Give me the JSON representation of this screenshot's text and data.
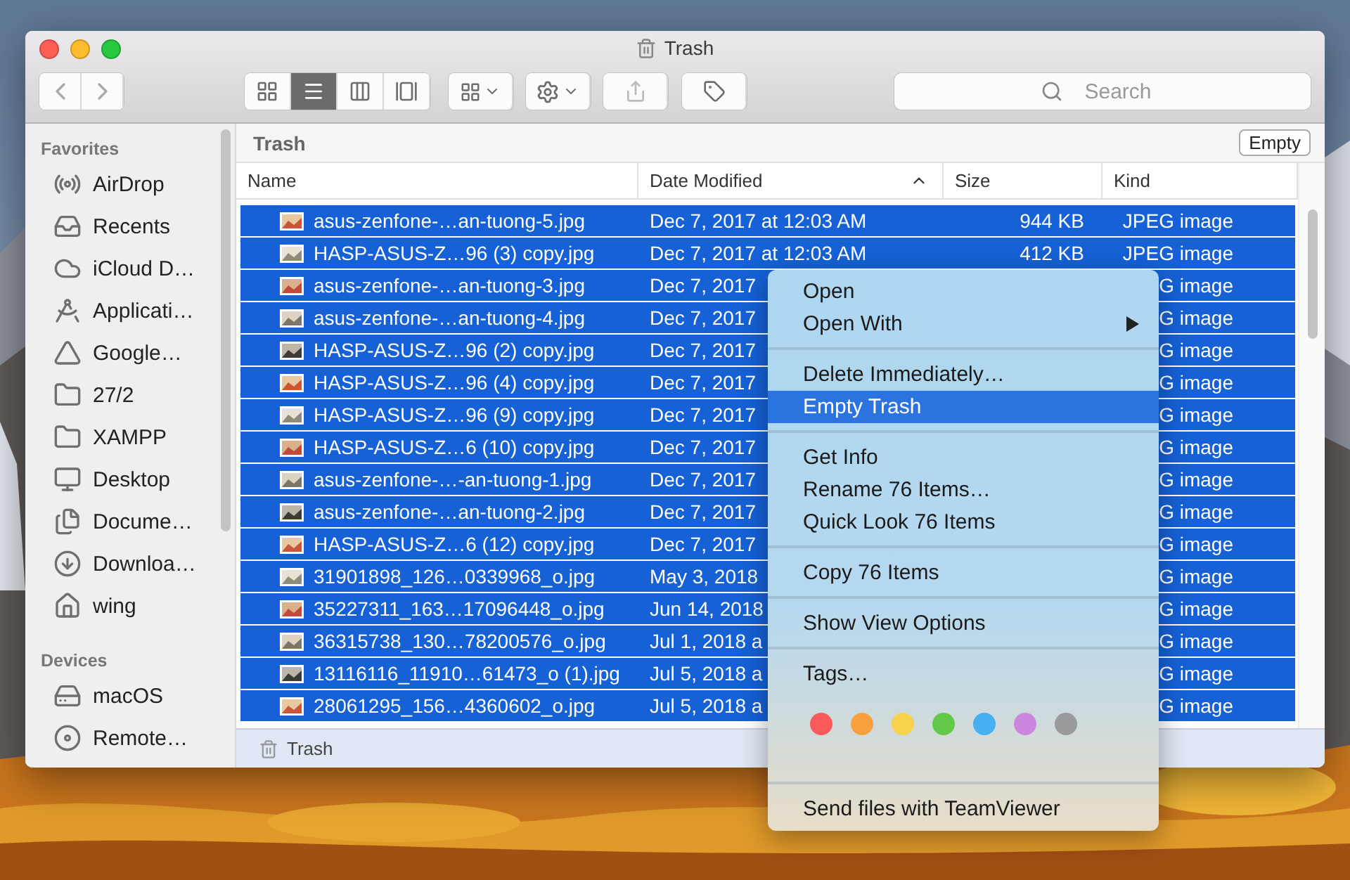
{
  "window": {
    "title": "Trash"
  },
  "toolbar": {
    "views": [
      {
        "kind": "icons",
        "selected": false
      },
      {
        "kind": "list",
        "selected": true
      },
      {
        "kind": "columns",
        "selected": false
      },
      {
        "kind": "gallery",
        "selected": false
      }
    ],
    "search": {
      "placeholder": "Search"
    }
  },
  "sidebar": {
    "sections": [
      {
        "title": "Favorites",
        "items": [
          {
            "label": "AirDrop",
            "kind": "airdrop"
          },
          {
            "label": "Recents",
            "kind": "recents"
          },
          {
            "label": "iCloud D…",
            "kind": "cloud"
          },
          {
            "label": "Applicati…",
            "kind": "apps"
          },
          {
            "label": "Google…",
            "kind": "gdrive"
          },
          {
            "label": "27/2",
            "kind": "folder"
          },
          {
            "label": "XAMPP",
            "kind": "folder"
          },
          {
            "label": "Desktop",
            "kind": "desktop"
          },
          {
            "label": "Docume…",
            "kind": "documents"
          },
          {
            "label": "Downloa…",
            "kind": "downloads"
          },
          {
            "label": "wing",
            "kind": "home"
          }
        ]
      },
      {
        "title": "Devices",
        "items": [
          {
            "label": "macOS",
            "kind": "disk"
          },
          {
            "label": "Remote…",
            "kind": "disc"
          }
        ]
      }
    ]
  },
  "path_bar": {
    "title": "Trash",
    "button": "Empty"
  },
  "table": {
    "columns": [
      {
        "label": "Name",
        "sorted": false
      },
      {
        "label": "Date Modified",
        "sorted": true
      },
      {
        "label": "Size",
        "sorted": false
      },
      {
        "label": "Kind",
        "sorted": false
      }
    ],
    "rows": [
      {
        "name": "asus-zenfone-…an-tuong-5.jpg",
        "date": "Dec 7, 2017 at 12:03 AM",
        "size": "944 KB",
        "kind": "JPEG image",
        "selected": true
      },
      {
        "name": "HASP-ASUS-Z…96 (3) copy.jpg",
        "date": "Dec 7, 2017 at 12:03 AM",
        "size": "412 KB",
        "kind": "JPEG image",
        "selected": true
      },
      {
        "name": "asus-zenfone-…an-tuong-3.jpg",
        "date": "Dec 7, 2017",
        "kind": "G image",
        "selected": true
      },
      {
        "name": "asus-zenfone-…an-tuong-4.jpg",
        "date": "Dec 7, 2017",
        "kind": "G image",
        "selected": true
      },
      {
        "name": "HASP-ASUS-Z…96 (2) copy.jpg",
        "date": "Dec 7, 2017",
        "kind": "G image",
        "selected": true
      },
      {
        "name": "HASP-ASUS-Z…96 (4) copy.jpg",
        "date": "Dec 7, 2017",
        "kind": "G image",
        "selected": true
      },
      {
        "name": "HASP-ASUS-Z…96 (9) copy.jpg",
        "date": "Dec 7, 2017",
        "kind": "G image",
        "selected": true
      },
      {
        "name": "HASP-ASUS-Z…6 (10) copy.jpg",
        "date": "Dec 7, 2017",
        "kind": "G image",
        "selected": true
      },
      {
        "name": "asus-zenfone-…-an-tuong-1.jpg",
        "date": "Dec 7, 2017",
        "kind": "G image",
        "selected": true
      },
      {
        "name": "asus-zenfone-…an-tuong-2.jpg",
        "date": "Dec 7, 2017",
        "kind": "G image",
        "selected": true
      },
      {
        "name": "HASP-ASUS-Z…6 (12) copy.jpg",
        "date": "Dec 7, 2017",
        "kind": "G image",
        "selected": true
      },
      {
        "name": "31901898_126…0339968_o.jpg",
        "date": "May 3, 2018",
        "kind": "G image",
        "selected": true
      },
      {
        "name": "35227311_163…17096448_o.jpg",
        "date": "Jun 14, 2018",
        "kind": "G image",
        "selected": true
      },
      {
        "name": "36315738_130…78200576_o.jpg",
        "date": "Jul 1, 2018 a",
        "kind": "G image",
        "selected": true
      },
      {
        "name": "13116116_11910…61473_o (1).jpg",
        "date": "Jul 5, 2018 a",
        "kind": "G image",
        "selected": true
      },
      {
        "name": "28061295_156…4360602_o.jpg",
        "date": "Jul 5, 2018 a",
        "kind": "G image",
        "selected": true
      }
    ]
  },
  "status_bar": {
    "title": "Trash"
  },
  "context_menu": {
    "items": [
      {
        "kind": "item",
        "label": "Open",
        "selected": false,
        "submenu": false
      },
      {
        "kind": "item",
        "label": "Open With",
        "selected": false,
        "submenu": true
      },
      {
        "kind": "separator"
      },
      {
        "kind": "item",
        "label": "Delete Immediately…",
        "selected": false,
        "submenu": false
      },
      {
        "kind": "item",
        "label": "Empty Trash",
        "selected": true,
        "submenu": false
      },
      {
        "kind": "separator"
      },
      {
        "kind": "item",
        "label": "Get Info",
        "selected": false,
        "submenu": false
      },
      {
        "kind": "item",
        "label": "Rename 76 Items…",
        "selected": false,
        "submenu": false
      },
      {
        "kind": "item",
        "label": "Quick Look 76 Items",
        "selected": false,
        "submenu": false
      },
      {
        "kind": "separator"
      },
      {
        "kind": "item",
        "label": "Copy 76 Items",
        "selected": false,
        "submenu": false
      },
      {
        "kind": "separator"
      },
      {
        "kind": "item",
        "label": "Show View Options",
        "selected": false,
        "submenu": false
      },
      {
        "kind": "separator"
      },
      {
        "kind": "item",
        "label": "Tags…",
        "selected": false,
        "submenu": false
      },
      {
        "kind": "tags",
        "tags": [
          {
            "color": "#fb5a5c"
          },
          {
            "color": "#f9a03e"
          },
          {
            "color": "#f7d24a"
          },
          {
            "color": "#62c84a"
          },
          {
            "color": "#47b0f3"
          },
          {
            "color": "#cc86e0"
          },
          {
            "color": "#9a9a9c"
          }
        ]
      },
      {
        "kind": "separator"
      },
      {
        "kind": "item",
        "label": "Send files with TeamViewer",
        "selected": false,
        "submenu": false
      }
    ]
  }
}
